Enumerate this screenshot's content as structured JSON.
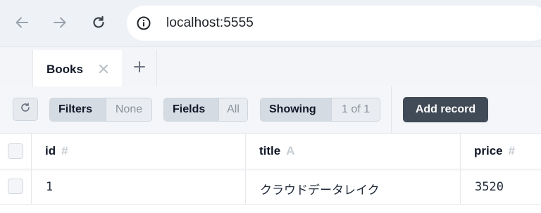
{
  "browser": {
    "url": "localhost:5555"
  },
  "tabs": [
    {
      "label": "Books",
      "active": true
    }
  ],
  "toolbar": {
    "filters": {
      "label": "Filters",
      "value": "None"
    },
    "fields": {
      "label": "Fields",
      "value": "All"
    },
    "showing": {
      "label": "Showing",
      "value": "1 of 1"
    },
    "add_record_label": "Add record"
  },
  "table": {
    "columns": [
      {
        "name": "id",
        "type_glyph": "#"
      },
      {
        "name": "title",
        "type_glyph": "A"
      },
      {
        "name": "price",
        "type_glyph": "#"
      }
    ],
    "rows": [
      {
        "id": "1",
        "title": "クラウドデータレイク",
        "price": "3520"
      }
    ]
  },
  "colors": {
    "accent_button": "#414a57",
    "browser_bar": "#eef2f7"
  }
}
